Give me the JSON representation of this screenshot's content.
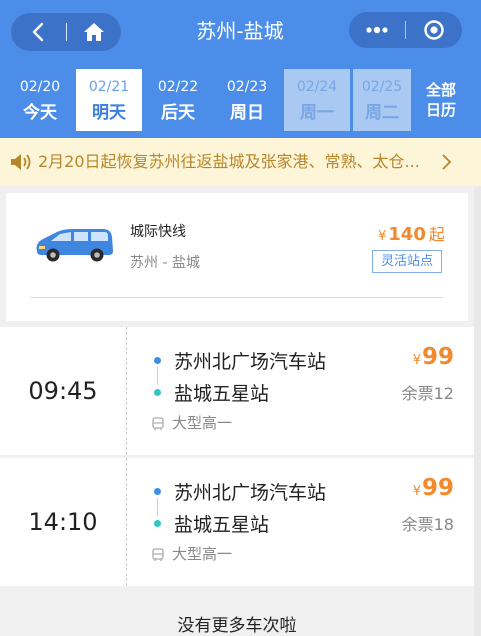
{
  "header": {
    "title": "苏州-盐城",
    "icons": {
      "back": "chevron-left-icon",
      "home": "home-icon",
      "more": "more-dots-icon",
      "close": "target-circle-icon"
    },
    "accent_color": "#4b8de8"
  },
  "dates": [
    {
      "date": "02/20",
      "label": "今天",
      "state": "normal"
    },
    {
      "date": "02/21",
      "label": "明天",
      "state": "active"
    },
    {
      "date": "02/22",
      "label": "后天",
      "state": "normal"
    },
    {
      "date": "02/23",
      "label": "周日",
      "state": "normal"
    },
    {
      "date": "02/24",
      "label": "周一",
      "state": "faded"
    },
    {
      "date": "02/25",
      "label": "周二",
      "state": "faded"
    }
  ],
  "calendar_button": {
    "line1": "全部",
    "line2": "日历"
  },
  "notice": {
    "text": "2月20日起恢复苏州往返盐城及张家港、常熟、太仓...",
    "icon": "speaker-icon"
  },
  "route": {
    "name": "城际快线",
    "sub": "苏州 - 盐城",
    "currency": "¥",
    "price": "140",
    "suffix": "起",
    "tag": "灵活站点",
    "price_color": "#f08a2c"
  },
  "trips": [
    {
      "time": "09:45",
      "from": "苏州北广场汽车站",
      "to": "盐城五星站",
      "bus_type": "大型高一",
      "currency": "¥",
      "price": "99",
      "remain": "余票12"
    },
    {
      "time": "14:10",
      "from": "苏州北广场汽车站",
      "to": "盐城五星站",
      "bus_type": "大型高一",
      "currency": "¥",
      "price": "99",
      "remain": "余票18"
    }
  ],
  "footer": {
    "text": "没有更多车次啦"
  }
}
